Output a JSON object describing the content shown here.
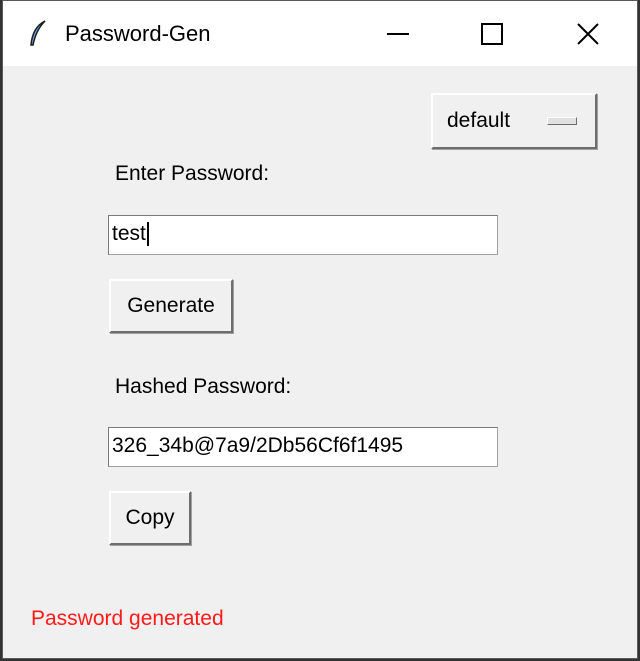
{
  "window": {
    "title": "Password-Gen"
  },
  "theme_menu": {
    "value": "default"
  },
  "password": {
    "label": "Enter Password:",
    "value": "test"
  },
  "generate_label": "Generate",
  "hashed": {
    "label": "Hashed Password:",
    "value": "326_34b@7a9/2Db56Cf6f1495"
  },
  "copy_label": "Copy",
  "status": {
    "text": "Password generated",
    "color": "#ff1a1a"
  }
}
